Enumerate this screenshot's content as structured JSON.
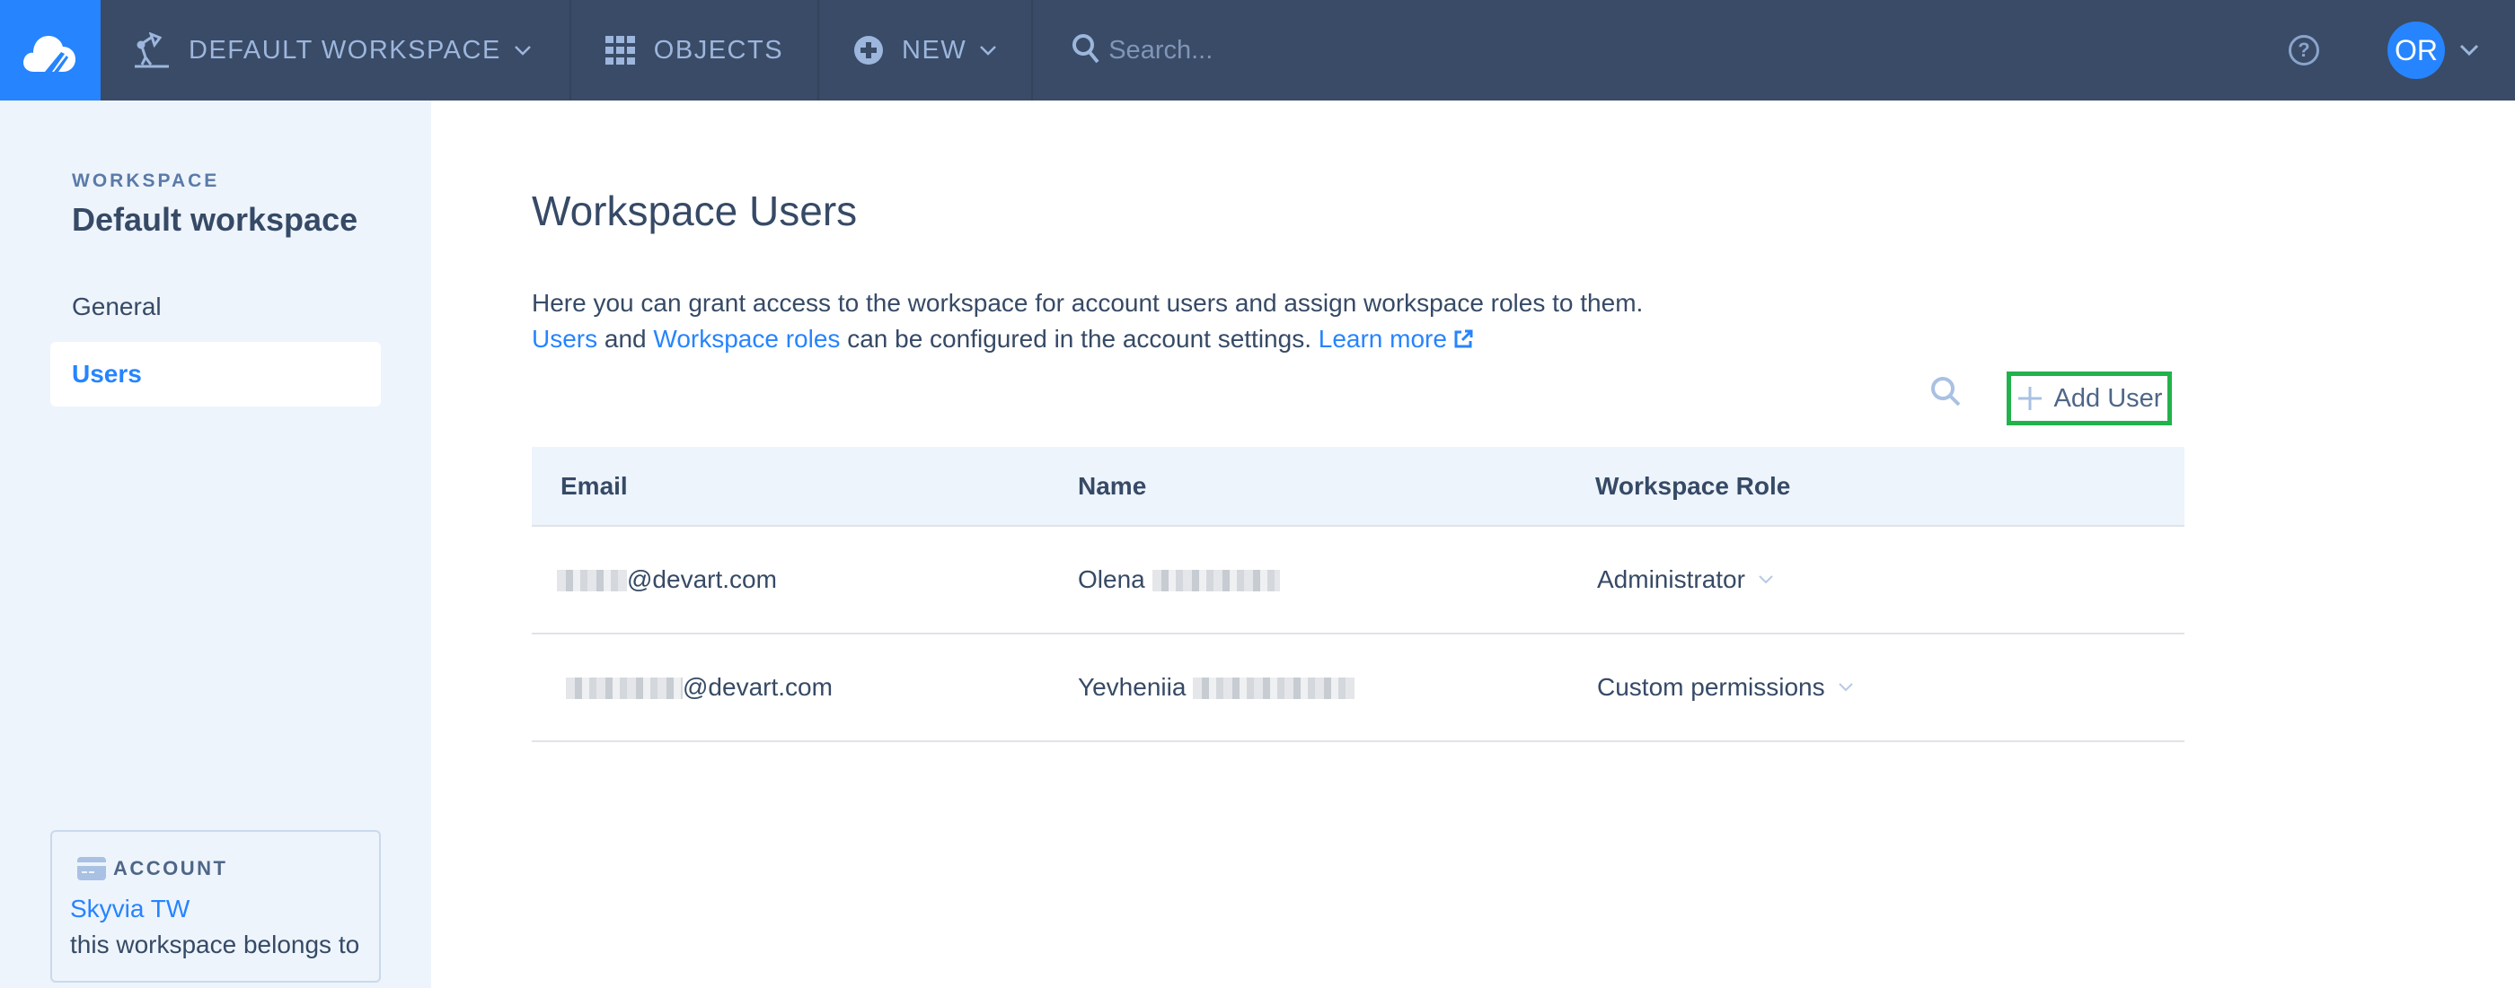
{
  "topbar": {
    "logo_icon": "cloud-logo-icon",
    "workspace_menu": {
      "label": "DEFAULT WORKSPACE",
      "icon": "desk-lamp-icon"
    },
    "objects": {
      "label": "OBJECTS",
      "icon": "grid-icon"
    },
    "new": {
      "label": "NEW",
      "icon": "plus-circle-icon"
    },
    "search": {
      "placeholder": "Search...",
      "value": ""
    },
    "help_icon": "?",
    "avatar_initials": "OR"
  },
  "sidebar": {
    "section_label": "WORKSPACE",
    "title": "Default workspace",
    "items": [
      {
        "label": "General",
        "active": false
      },
      {
        "label": "Users",
        "active": true
      }
    ],
    "account": {
      "label": "ACCOUNT",
      "name": "Skyvia TW",
      "description": "this workspace belongs to"
    }
  },
  "main": {
    "title": "Workspace Users",
    "description_line1": "Here you can grant access to the workspace for account users and assign workspace roles to them.",
    "description_line2": {
      "link_users": "Users",
      "text_and": " and ",
      "link_roles": "Workspace roles",
      "text_rest": " can be configured in the account settings. ",
      "link_learn": "Learn more"
    },
    "add_user_label": "Add User",
    "table": {
      "columns": [
        "Email",
        "Name",
        "Workspace Role"
      ],
      "rows": [
        {
          "email_domain": "@devart.com",
          "first_name": "Olena",
          "role": "Administrator"
        },
        {
          "email_domain": "@devart.com",
          "first_name": "Yevheniia",
          "role": "Custom permissions"
        }
      ]
    }
  },
  "colors": {
    "topbar_bg": "#394b66",
    "brand_blue": "#2684ff",
    "sidebar_bg": "#eef4fc",
    "highlight_border": "#22b24c"
  }
}
